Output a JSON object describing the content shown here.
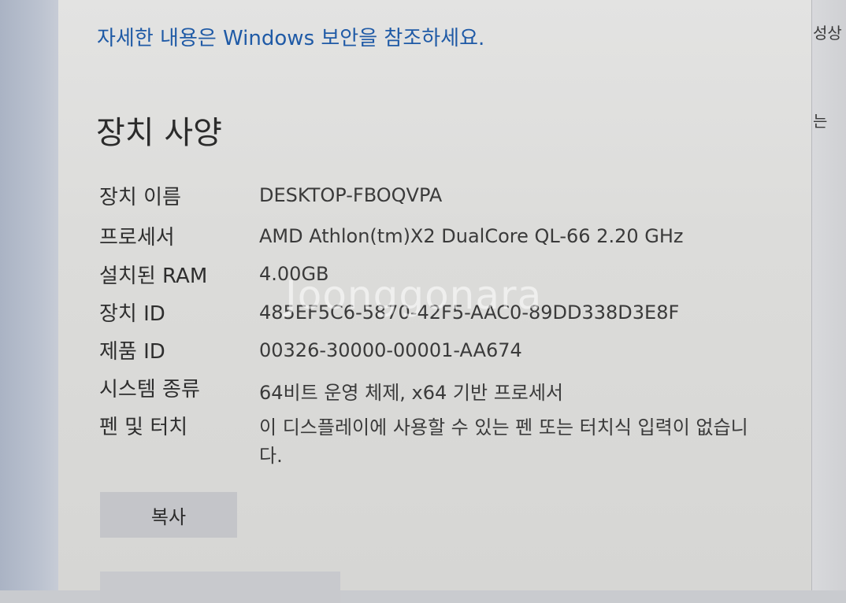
{
  "security_link": "자세한 내용은 Windows 보안을 참조하세요.",
  "section_title": "장치 사양",
  "specs": [
    {
      "label": "장치 이름",
      "value": "DESKTOP-FBOQVPA"
    },
    {
      "label": "프로세서",
      "value": "AMD Athlon(tm)X2 DualCore QL-66    2.20 GHz"
    },
    {
      "label": "설치된 RAM",
      "value": "4.00GB"
    },
    {
      "label": "장치 ID",
      "value": "485EF5C6-5870-42F5-AAC0-89DD338D3E8F"
    },
    {
      "label": "제품 ID",
      "value": "00326-30000-00001-AA674"
    },
    {
      "label": "시스템 종류",
      "value": "64비트 운영 체제, x64 기반 프로세서"
    },
    {
      "label": "펜 및 터치",
      "value": "이 디스플레이에 사용할 수 있는 펜 또는 터치식 입력이 없습니다."
    }
  ],
  "copy_button": "복사",
  "watermark": "Joonggonara",
  "side_texts": [
    "성상",
    "는"
  ]
}
